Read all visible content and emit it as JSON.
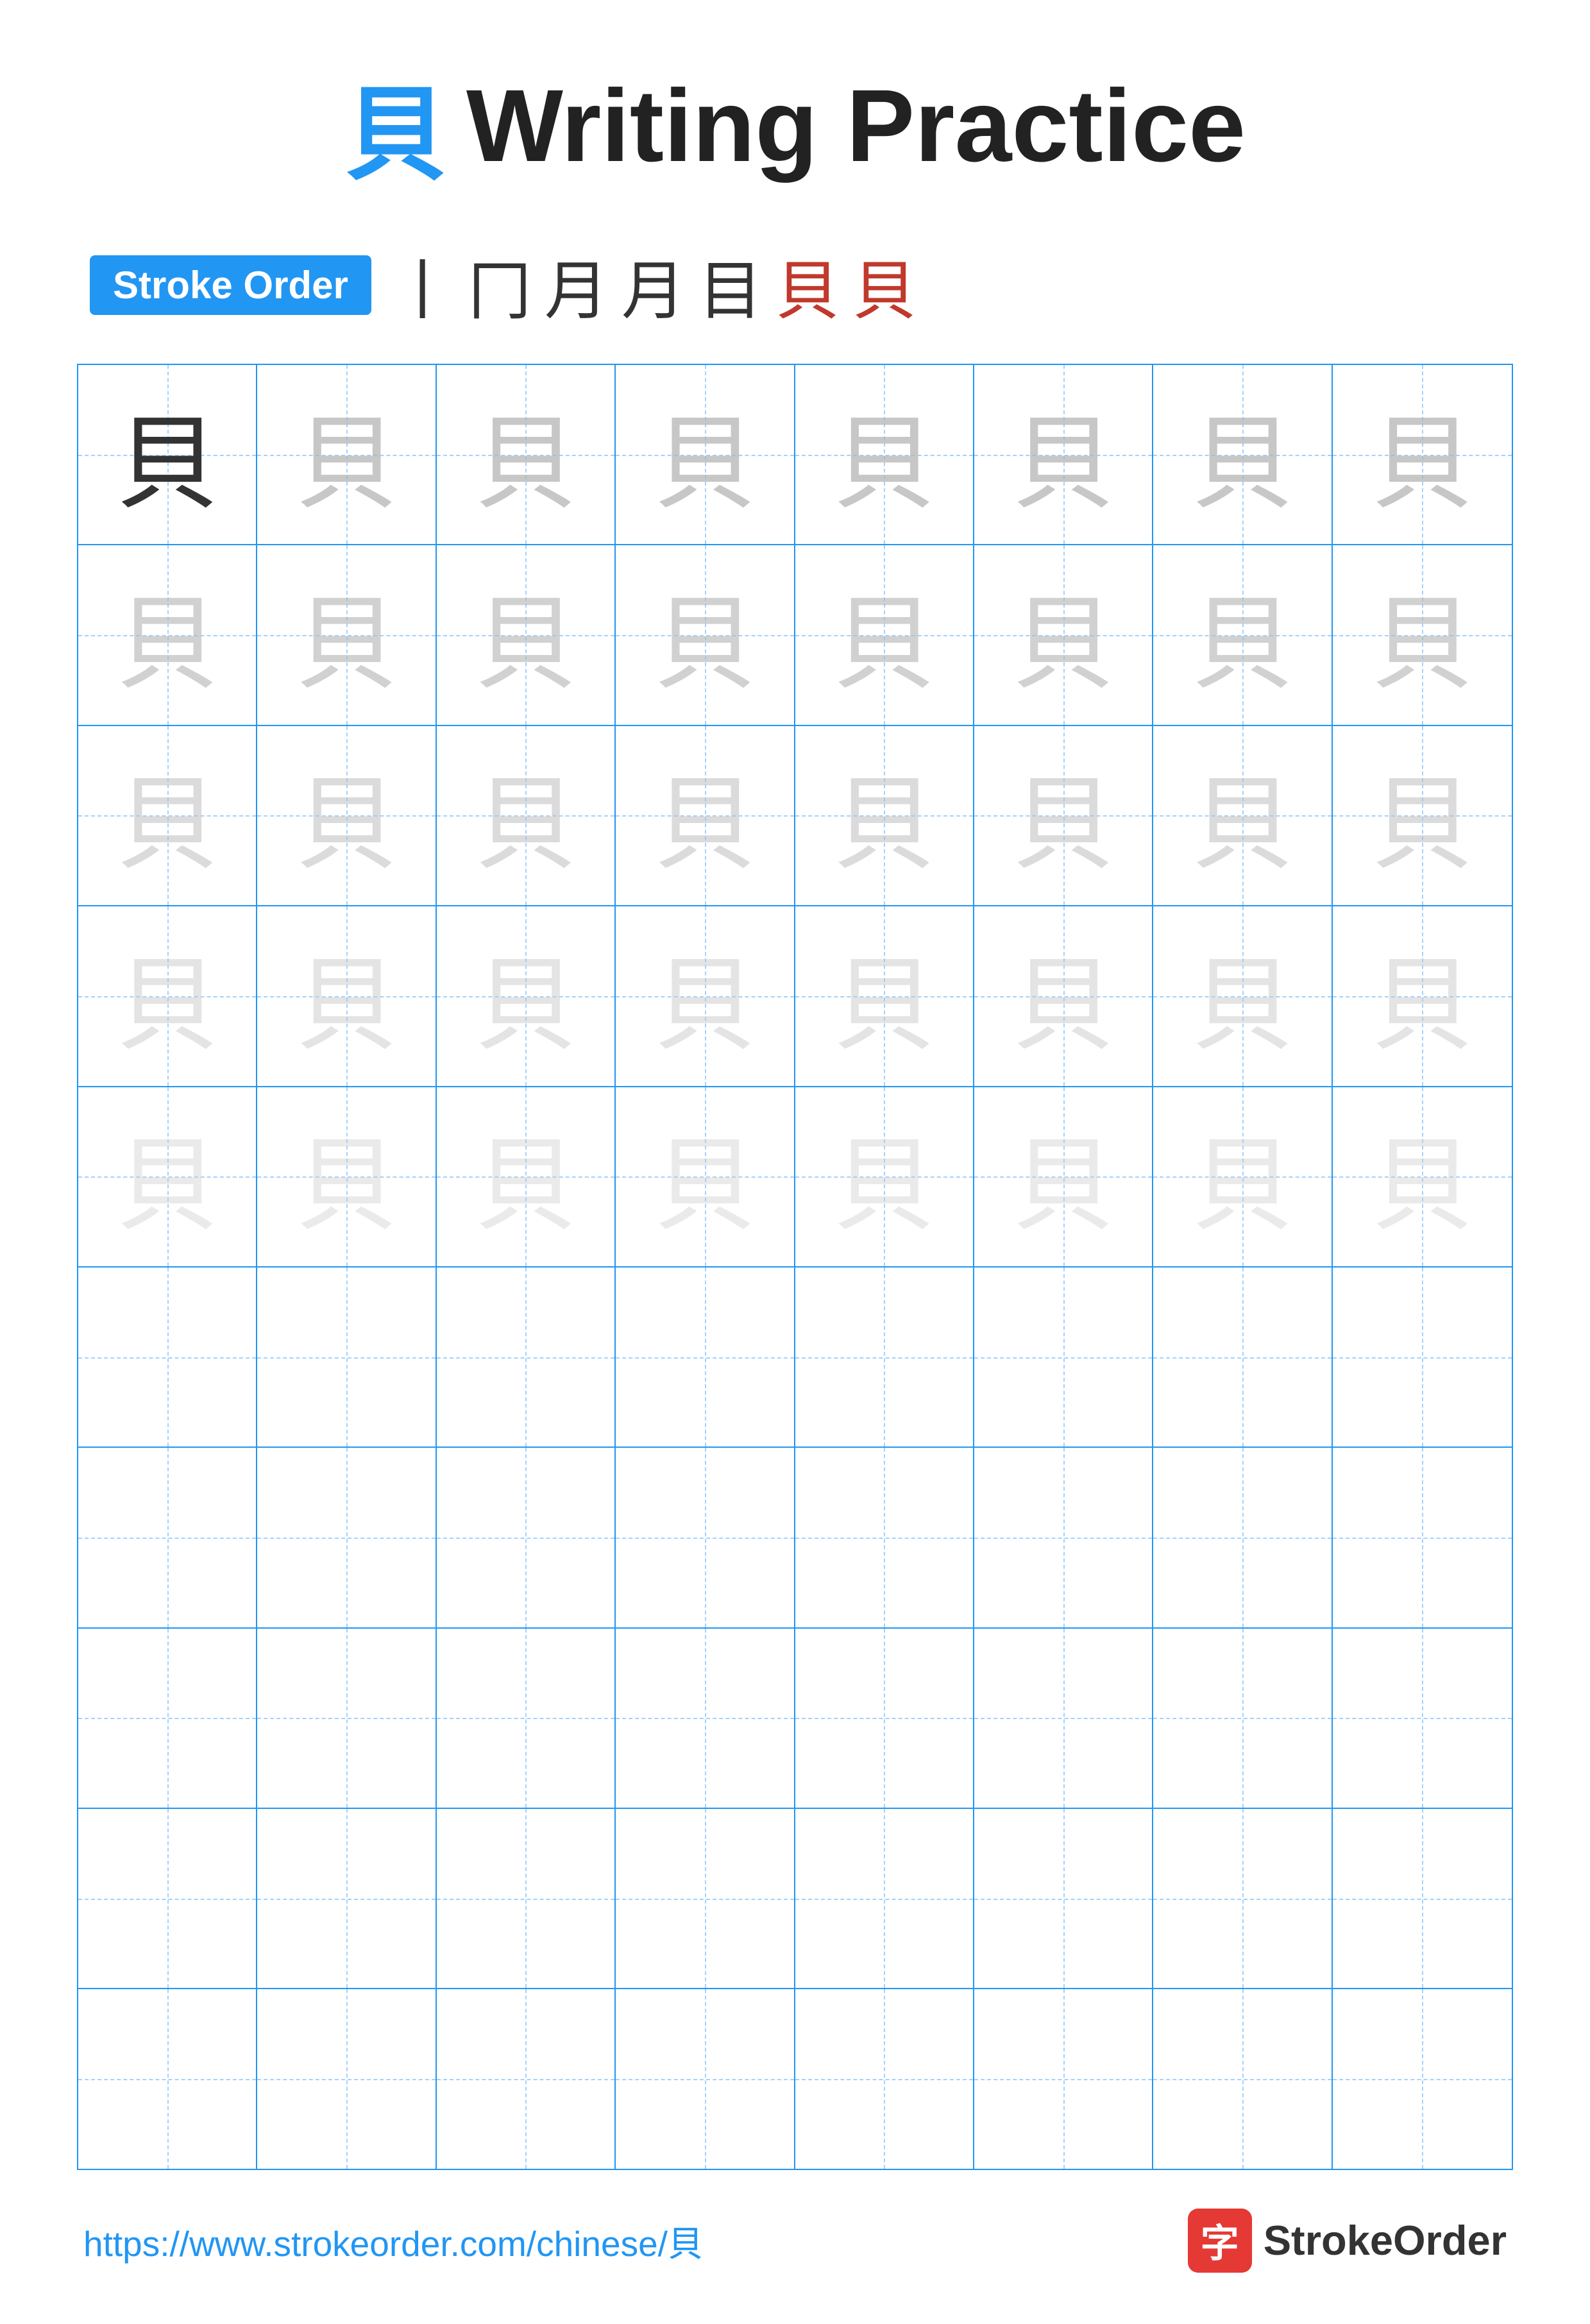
{
  "title": {
    "char": "貝",
    "text": "Writing Practice"
  },
  "stroke_order": {
    "badge_label": "Stroke Order",
    "steps": [
      "丨",
      "冂",
      "月",
      "月",
      "目",
      "貝",
      "貝"
    ]
  },
  "grid": {
    "rows": 10,
    "cols": 8,
    "char": "貝",
    "filled_rows": 5,
    "empty_rows": 5
  },
  "footer": {
    "url": "https://www.strokeorder.com/chinese/貝",
    "brand_char": "字",
    "brand_name": "StrokeOrder"
  }
}
